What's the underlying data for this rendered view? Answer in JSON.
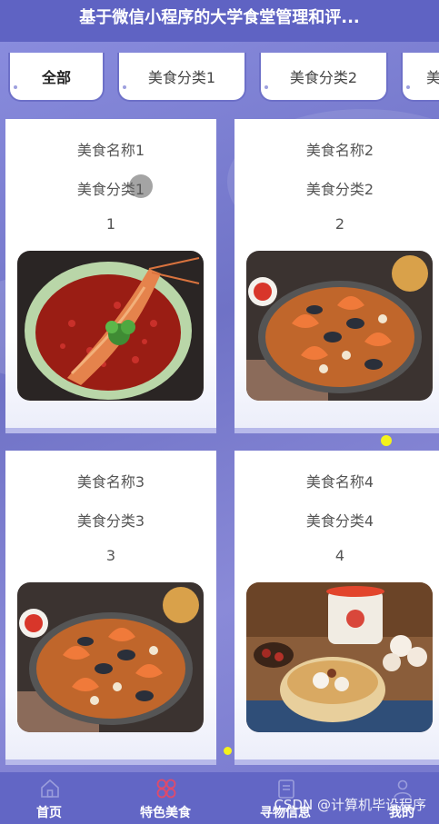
{
  "header": {
    "title": "基于微信小程序的大学食堂管理和评..."
  },
  "tabs": [
    {
      "label": "全部",
      "active": true
    },
    {
      "label": "美食分类1",
      "active": false
    },
    {
      "label": "美食分类2",
      "active": false
    },
    {
      "label": "美食",
      "active": false
    }
  ],
  "foods": [
    {
      "name": "美食名称1",
      "category": "美食分类1",
      "number": "1",
      "image": "crayfish-dish-image"
    },
    {
      "name": "美食名称2",
      "category": "美食分类2",
      "number": "2",
      "image": "seafood-paella-image"
    },
    {
      "name": "美食名称3",
      "category": "美食分类3",
      "number": "3",
      "image": "seafood-paella-image"
    },
    {
      "name": "美食名称4",
      "category": "美食分类4",
      "number": "4",
      "image": "soup-bowl-image"
    }
  ],
  "tabbar": [
    {
      "label": "首页",
      "icon": "home-icon",
      "active": false
    },
    {
      "label": "特色美食",
      "icon": "flower-icon",
      "active": true
    },
    {
      "label": "寻物信息",
      "icon": "notebook-icon",
      "active": false
    },
    {
      "label": "我的",
      "icon": "user-icon",
      "active": false
    }
  ],
  "watermark": "CSDN @计算机毕设程序",
  "colors": {
    "header": "#5f63c3",
    "active_tab_icon": "#e04a6a",
    "tab_border": "#6d70c8"
  }
}
